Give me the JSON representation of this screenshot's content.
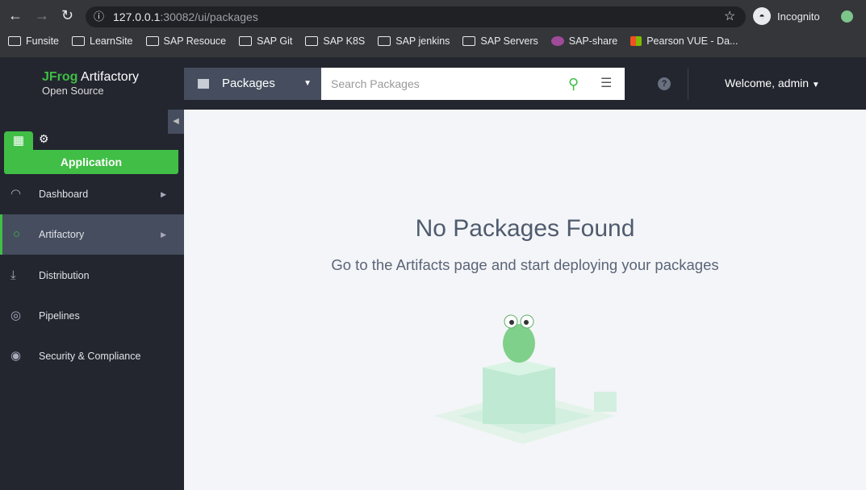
{
  "browser": {
    "url_host": "127.0.0.1",
    "url_rest": ":30082/ui/packages",
    "profile": "Incognito",
    "bookmarks": [
      "Funsite",
      "LearnSite",
      "SAP Resouce",
      "SAP Git",
      "SAP K8S",
      "SAP jenkins",
      "SAP Servers",
      "SAP-share",
      "Pearson VUE - Da..."
    ]
  },
  "header": {
    "brand": "JFrog",
    "product": "Artifactory",
    "edition": "Open Source",
    "package_type": "Packages",
    "search_placeholder": "Search Packages",
    "welcome": "Welcome, admin"
  },
  "sidebar": {
    "app_label": "Application",
    "items": [
      {
        "label": "Dashboard"
      },
      {
        "label": "Artifactory"
      },
      {
        "label": "Distribution"
      },
      {
        "label": "Pipelines"
      },
      {
        "label": "Security & Compliance"
      }
    ]
  },
  "main": {
    "title": "No Packages Found",
    "message": "Go to the Artifacts page and start deploying your packages"
  }
}
